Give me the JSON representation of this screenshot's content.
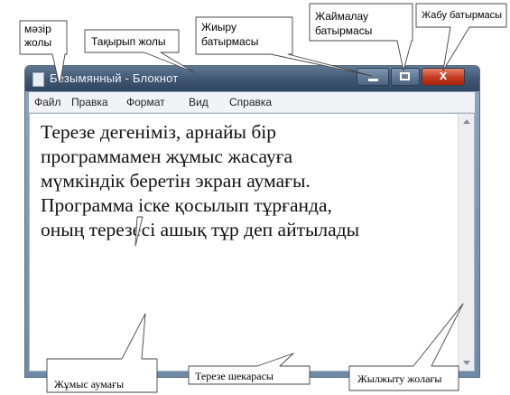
{
  "window": {
    "title": "Безымянный - Блокнот",
    "menu": [
      "Файл",
      "Правка",
      "Формат",
      "Вид",
      "Справка"
    ],
    "close_glyph": "x"
  },
  "content_lines": [
    "Терезе дегеніміз, арнайы бір",
    "программамен жұмыс жасауға",
    "мүмкіндік беретін экран аумағы.",
    "Программа іске қосылып тұрғанда,",
    "оның терезесі ашық тұр деп айтылады"
  ],
  "callouts": {
    "menu_bar": [
      "мәзір",
      "жолы"
    ],
    "title_bar": "Тақырып жолы",
    "minimize_button": [
      "Жиыру",
      "батырмасы"
    ],
    "maximize_button": [
      "Жаймалау",
      "батырмасы"
    ],
    "close_button": "Жабу батырмасы",
    "work_area": "Жұмыс аумағы",
    "window_border": "Терезе шекарасы",
    "scrollbar": "Жылжыту жолағы"
  },
  "icons": [
    "notepad-icon",
    "minimize-icon",
    "maximize-icon",
    "close-icon",
    "scroll-up-arrow-icon",
    "scroll-down-arrow-icon"
  ]
}
